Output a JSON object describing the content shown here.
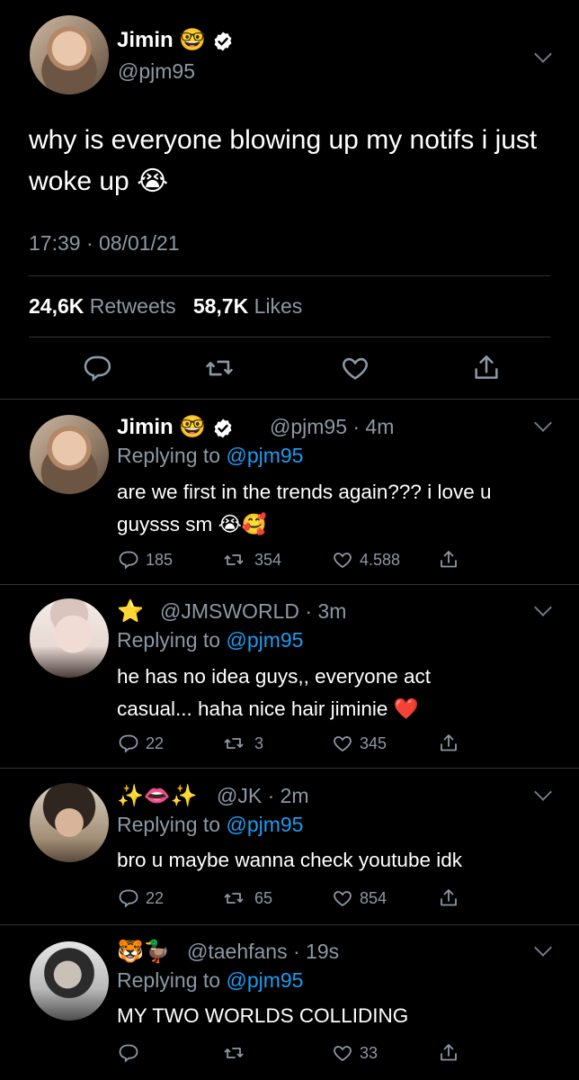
{
  "main_tweet": {
    "name": "Jimin",
    "name_emoji": "🤓",
    "handle": "@pjm95",
    "text": "why is everyone blowing up my notifs i just woke up",
    "text_emoji": "😭",
    "time": "17:39 · 08/01/21",
    "retweets_count": "24,6K",
    "retweets_label": "Retweets",
    "likes_count": "58,7K",
    "likes_label": "Likes"
  },
  "replies": [
    {
      "name": "Jimin",
      "name_emoji": "🤓",
      "handle_time": "@pjm95 · 4m",
      "replying_prefix": "Replying to",
      "replying_handle": "@pjm95",
      "text_line1": "are we first in the trends again??? i love u",
      "text_line2": "guysss sm",
      "text_emoji": "😭🥰",
      "reply_count": "185",
      "retweet_count": "354",
      "like_count": "4.588"
    },
    {
      "name_emoji": "⭐",
      "handle_time": "@JMSWORLD · 3m",
      "replying_prefix": "Replying to",
      "replying_handle": "@pjm95",
      "text_line1": "he has no idea guys,, everyone act",
      "text_line2": "casual... haha nice hair jiminie",
      "text_emoji": "❤️",
      "reply_count": "22",
      "retweet_count": "3",
      "like_count": "345"
    },
    {
      "name_emoji": "✨👄✨",
      "handle_time": "@JK · 2m",
      "replying_prefix": "Replying to",
      "replying_handle": "@pjm95",
      "text_line1": "bro u maybe wanna check youtube idk",
      "reply_count": "22",
      "retweet_count": "65",
      "like_count": "854"
    },
    {
      "name_emoji": "🐯🦆",
      "handle_time": "@taehfans · 19s",
      "replying_prefix": "Replying to",
      "replying_handle": "@pjm95",
      "text_line1": "MY TWO WORLDS COLLIDING",
      "like_count": "33"
    }
  ],
  "colors": {
    "background": "#000000",
    "secondary_text": "#8b98a5",
    "link": "#1d9bf0",
    "divider": "#2f3336",
    "verified": "#ffffff"
  },
  "icons": [
    "reply-icon",
    "retweet-icon",
    "like-icon",
    "share-icon",
    "verified-badge-icon",
    "chevron-down-icon"
  ]
}
